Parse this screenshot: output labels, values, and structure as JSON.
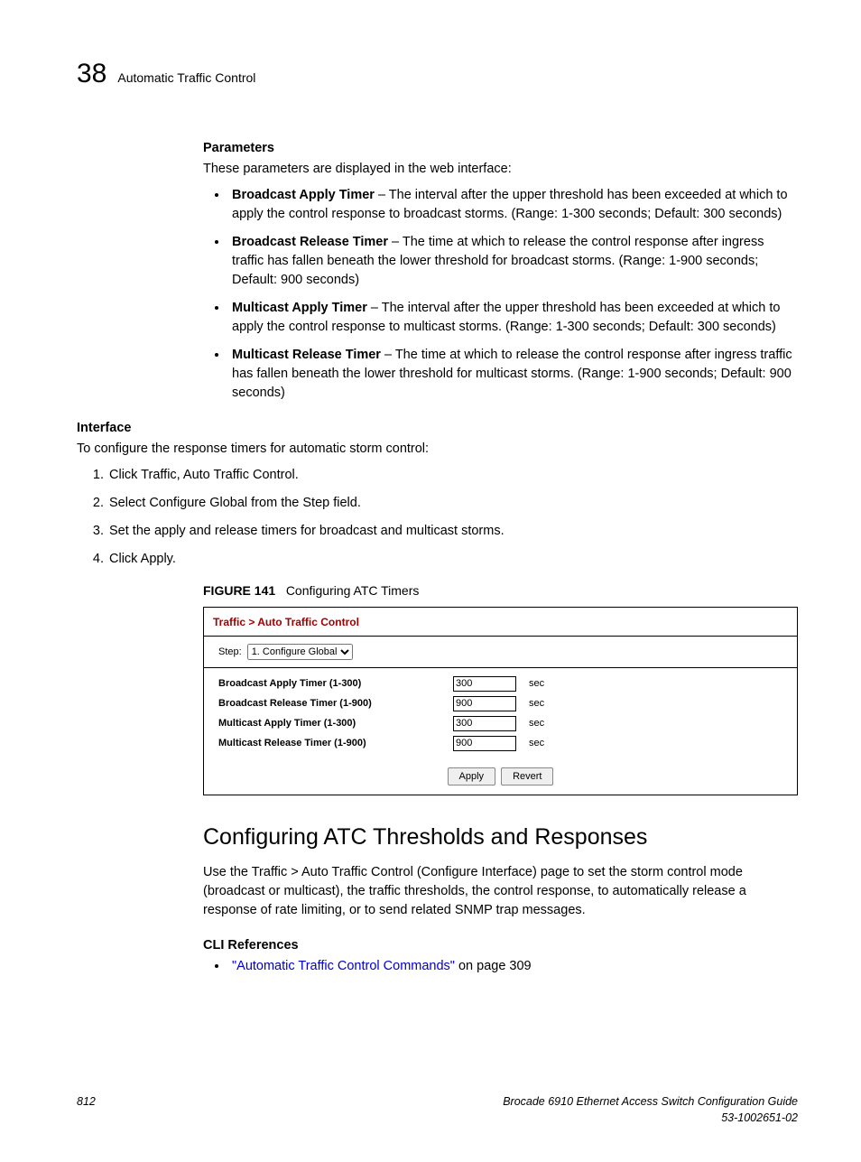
{
  "header": {
    "chapter_num": "38",
    "chapter_title": "Automatic Traffic Control"
  },
  "parameters": {
    "heading": "Parameters",
    "intro": "These parameters are displayed in the web interface:",
    "items": [
      {
        "term": "Broadcast Apply Timer",
        "desc": " – The interval after the upper threshold has been exceeded at which to apply the control response to broadcast storms. (Range: 1-300 seconds; Default: 300 seconds)"
      },
      {
        "term": "Broadcast Release Timer",
        "desc": " – The time at which to release the control response after ingress traffic has fallen beneath the lower threshold for broadcast storms. (Range: 1-900 seconds; Default: 900 seconds)"
      },
      {
        "term": "Multicast Apply Timer",
        "desc": " – The interval after the upper threshold has been exceeded at which to apply the control response to multicast storms. (Range: 1-300 seconds; Default: 300 seconds)"
      },
      {
        "term": "Multicast Release Timer",
        "desc": " – The time at which to release the control response after ingress traffic has fallen beneath the lower threshold for multicast storms. (Range: 1-900 seconds; Default: 900 seconds)"
      }
    ]
  },
  "interface": {
    "heading": "Interface",
    "intro": "To configure the response timers for automatic storm control:",
    "steps": [
      "Click Traffic, Auto Traffic Control.",
      "Select Configure Global from the Step field.",
      "Set the apply and release timers for broadcast and multicast storms.",
      "Click Apply."
    ]
  },
  "figure": {
    "label": "FIGURE 141",
    "caption": "Configuring ATC Timers",
    "panel": {
      "title": "Traffic > Auto Traffic Control",
      "step_label": "Step:",
      "step_value": "1. Configure Global",
      "rows": [
        {
          "label": "Broadcast Apply Timer (1-300)",
          "value": "300",
          "unit": "sec"
        },
        {
          "label": "Broadcast Release Timer (1-900)",
          "value": "900",
          "unit": "sec"
        },
        {
          "label": "Multicast Apply Timer (1-300)",
          "value": "300",
          "unit": "sec"
        },
        {
          "label": "Multicast Release Timer (1-900)",
          "value": "900",
          "unit": "sec"
        }
      ],
      "apply": "Apply",
      "revert": "Revert"
    }
  },
  "section2": {
    "heading": "Configuring ATC Thresholds and Responses",
    "body": "Use the Traffic > Auto Traffic Control (Configure Interface) page to set the storm control mode (broadcast or multicast), the traffic thresholds, the control response, to automatically release a response of rate limiting, or to send related SNMP trap messages.",
    "cli_heading": "CLI References",
    "cli_link": "\"Automatic Traffic Control Commands\"",
    "cli_tail": " on page 309"
  },
  "footer": {
    "page": "812",
    "doc1": "Brocade 6910 Ethernet Access Switch Configuration Guide",
    "doc2": "53-1002651-02"
  }
}
